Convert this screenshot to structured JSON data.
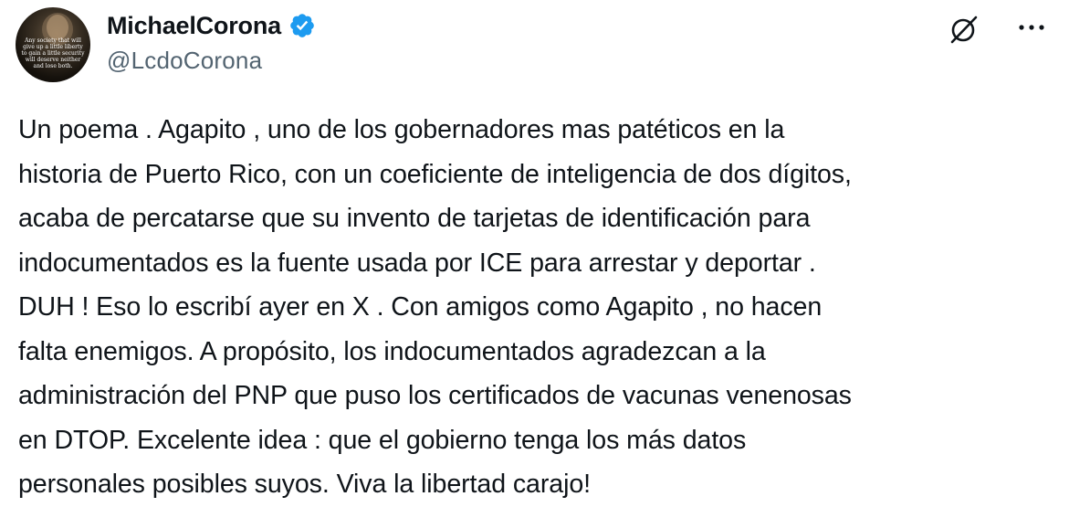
{
  "author": {
    "display_name": "MichaelCorona",
    "handle": "@LcdoCorona",
    "verified": true,
    "avatar_text": "Any society that will give up a little liberty to gain a little security will deserve neither and lose both."
  },
  "actions": {
    "grok_icon": "grok-slash-icon",
    "more_icon": "more-dots-icon"
  },
  "tweet": {
    "text": "Un poema . Agapito , uno de los gobernadores mas patéticos en la\nhistoria de Puerto Rico, con un coeficiente de inteligencia de dos dígitos,\nacaba de percatarse que su invento de tarjetas de identificación para\nindocumentados es la fuente usada por ICE para arrestar y deportar .\nDUH ! Eso lo escribí ayer en X . Con amigos como Agapito , no hacen\nfalta enemigos. A propósito, los indocumentados agradezcan a la\nadministración del PNP que puso los certificados de vacunas venenosas\nen DTOP. Excelente idea : que el gobierno tenga los más datos\npersonales posibles suyos. Viva la libertad carajo!"
  },
  "colors": {
    "text": "#0f1419",
    "secondary": "#536471",
    "verified_blue": "#1d9bf0"
  }
}
